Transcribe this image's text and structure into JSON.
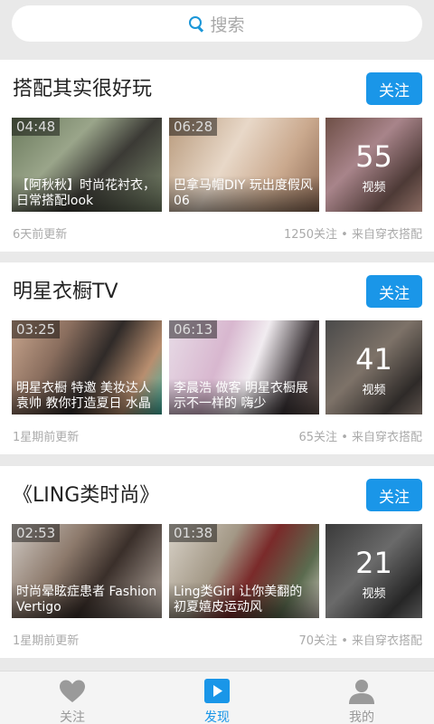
{
  "search": {
    "placeholder": "搜索"
  },
  "cards": [
    {
      "title": "搭配其实很好玩",
      "follow_label": "关注",
      "videos": [
        {
          "duration": "04:48",
          "caption": "【阿秋秋】时尚花衬衣，日常搭配look"
        },
        {
          "duration": "06:28",
          "caption": "巴拿马帽DIY 玩出度假风 06"
        }
      ],
      "more_count": "55",
      "more_label": "视频",
      "updated": "6天前更新",
      "stats": "1250关注 • 来自穿衣搭配"
    },
    {
      "title": "明星衣橱TV",
      "follow_label": "关注",
      "videos": [
        {
          "duration": "03:25",
          "caption": "明星衣橱 特邀 美妆达人 袁帅 教你打造夏日 水晶"
        },
        {
          "duration": "06:13",
          "caption": "李晨浩 做客 明星衣橱展示不一样的 嗨少"
        }
      ],
      "more_count": "41",
      "more_label": "视频",
      "updated": "1星期前更新",
      "stats": "65关注 • 来自穿衣搭配"
    },
    {
      "title": "《LING类时尚》",
      "follow_label": "关注",
      "videos": [
        {
          "duration": "02:53",
          "caption": "时尚晕眩症患者 Fashion Vertigo"
        },
        {
          "duration": "01:38",
          "caption": "Ling类Girl 让你美翻的初夏嬉皮运动风"
        }
      ],
      "more_count": "21",
      "more_label": "视频",
      "updated": "1星期前更新",
      "stats": "70关注 • 来自穿衣搭配"
    }
  ],
  "tabs": [
    {
      "label": "关注",
      "icon": "heart-icon",
      "active": false
    },
    {
      "label": "发现",
      "icon": "play-icon",
      "active": true
    },
    {
      "label": "我的",
      "icon": "person-icon",
      "active": false
    }
  ],
  "colors": {
    "accent": "#1a96e8",
    "background": "#e9e9e9"
  }
}
